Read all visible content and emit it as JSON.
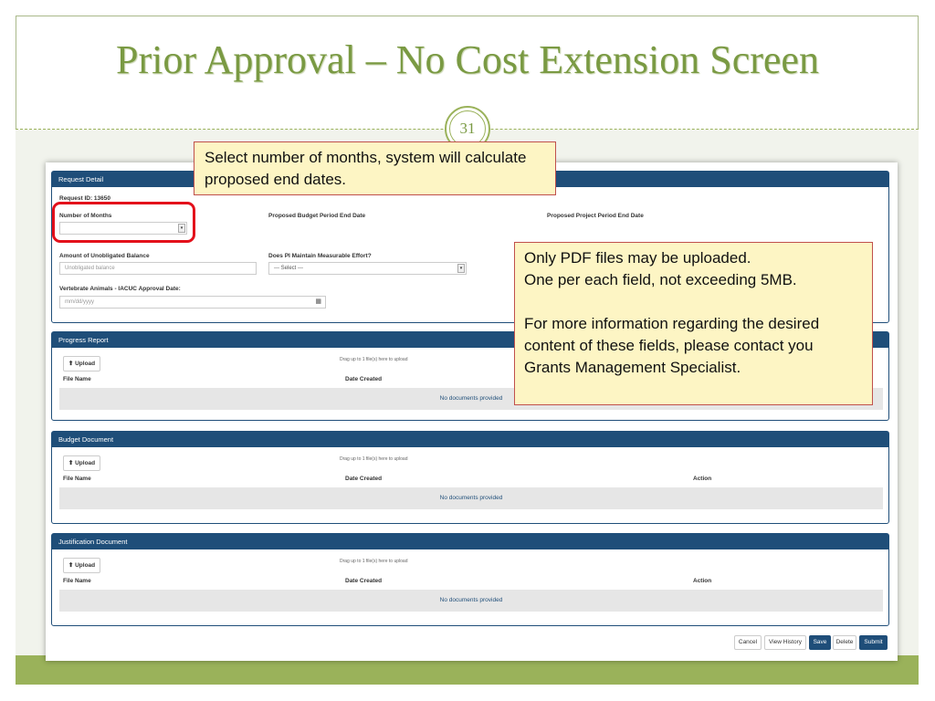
{
  "slide": {
    "title": "Prior Approval – No Cost Extension Screen",
    "page_number": "31"
  },
  "callouts": {
    "top": "Select number of months, system will calculate proposed end dates.",
    "side_line1": "Only PDF files may be uploaded.",
    "side_line2": "One per each field, not exceeding 5MB.",
    "side_para2": "For more information regarding the desired content of these fields, please contact you Grants Management Specialist."
  },
  "request_detail": {
    "header": "Request Detail",
    "request_id": "Request ID: 13650",
    "months_label": "Number of Months",
    "budget_end_label": "Proposed Budget Period End Date",
    "project_end_label": "Proposed Project Period End Date",
    "unobligated_label": "Amount of Unobligated Balance",
    "unobligated_placeholder": "Unobligated balance",
    "pi_effort_label": "Does PI Maintain Measurable Effort?",
    "pi_effort_value": "--- Select ---",
    "iacuc_label": "Vertebrate Animals - IACUC Approval Date:",
    "iacuc_placeholder": "mm/dd/yyyy"
  },
  "sections": {
    "progress": {
      "header": "Progress Report"
    },
    "budget": {
      "header": "Budget Document"
    },
    "justification": {
      "header": "Justification Document"
    }
  },
  "common": {
    "upload_label": "Upload",
    "drag_text": "Drag up to 1 file(s) here to upload",
    "col_file": "File Name",
    "col_date": "Date Created",
    "col_action": "Action",
    "empty_text": "No documents provided"
  },
  "footer_buttons": {
    "cancel": "Cancel",
    "view_history": "View History",
    "save": "Save",
    "delete": "Delete",
    "submit": "Submit"
  },
  "icons": {
    "upload": "upload-icon",
    "calendar": "calendar-icon",
    "dropdown": "chevron-down-icon"
  },
  "colors": {
    "panel_header": "#1f4e79",
    "slide_green": "#9ab25a",
    "callout_fill": "#fdf5c4",
    "callout_border": "#c0504d",
    "highlight": "#e3101b"
  }
}
